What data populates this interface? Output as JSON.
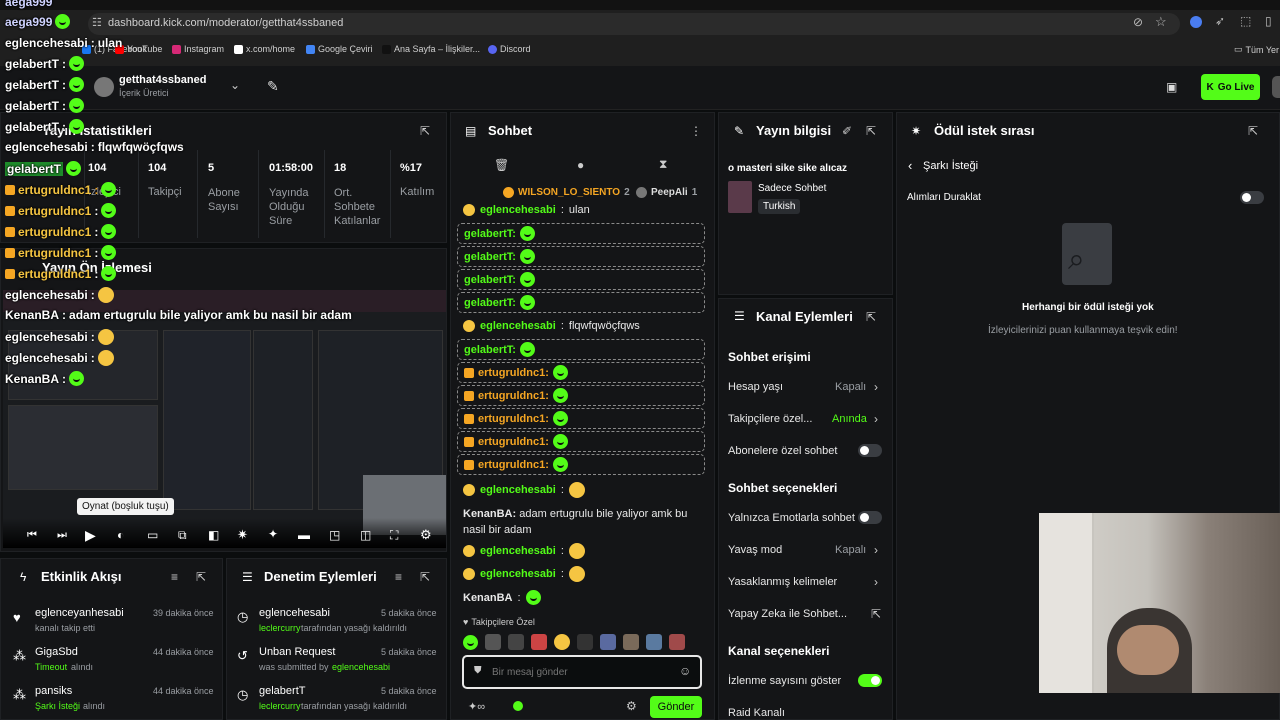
{
  "browser": {
    "url": "dashboard.kick.com/moderator/getthat4ssbaned",
    "bookmarks": [
      "(1) Facebook",
      "YouTube",
      "Instagram",
      "x.com/home",
      "Google Çeviri",
      "Ana Sayfa – İlişkiler...",
      "Discord"
    ],
    "all_bookmarks": "Tüm Yer"
  },
  "header": {
    "channel_name": "getthat4ssbaned",
    "role": "İçerik Üretici",
    "go_live": "Go Live"
  },
  "stats": {
    "title": "Yayın İstatistikleri",
    "values": [
      "104",
      "104",
      "5",
      "01:58:00",
      "18",
      "%17"
    ],
    "labels": [
      "İzleyici",
      "Takipçi",
      "Abone Sayısı",
      "Yayında Olduğu Süre",
      "Ort. Sohbete Katılanlar",
      "Katılım"
    ]
  },
  "preview": {
    "title": "Yayın Ön İzlemesi",
    "tooltip": "Oynat (boşluk tuşu)"
  },
  "overlay": [
    {
      "user": "aega999",
      "text": ""
    },
    {
      "user": "aega999",
      "text": ""
    },
    {
      "user": "eglencehesabi",
      "text": "ulan"
    },
    {
      "user": "gelabertT",
      "text": ""
    },
    {
      "user": "gelabertT",
      "text": ""
    },
    {
      "user": "gelabertT",
      "text": ""
    },
    {
      "user": "gelabertT",
      "text": ""
    },
    {
      "user": "eglencehesabi",
      "text": "flqwfqwöçfqws"
    },
    {
      "user": "gelabertT",
      "text": ""
    },
    {
      "user": "ertugruldnc1",
      "text": ""
    },
    {
      "user": "ertugruldnc1",
      "text": ""
    },
    {
      "user": "ertugruldnc1",
      "text": ""
    },
    {
      "user": "ertugruldnc1",
      "text": ""
    },
    {
      "user": "ertugruldnc1",
      "text": ""
    },
    {
      "user": "eglencehesabi",
      "text": ""
    },
    {
      "user": "KenanBA",
      "text": "adam ertugrulu bile yaliyor amk bu nasil bir adam"
    },
    {
      "user": "eglencehesabi",
      "text": ""
    },
    {
      "user": "eglencehesabi",
      "text": ""
    },
    {
      "user": "KenanBA",
      "text": ""
    }
  ],
  "activity": {
    "title": "Etkinlik Akışı",
    "items": [
      {
        "name": "eglenceyanhesabi",
        "desc": "kanalı takip etti",
        "time": "39 dakika önce"
      },
      {
        "name": "GigaSbd",
        "desc_hl": "Timeout",
        "desc": "alındı",
        "time": "44 dakika önce"
      },
      {
        "name": "pansiks",
        "desc_hl": "Şarkı İsteği",
        "desc": "alındı",
        "time": "44 dakika önce"
      }
    ]
  },
  "moderation": {
    "title": "Denetim Eylemleri",
    "items": [
      {
        "name": "eglencehesabi",
        "by": "leclercurry",
        "desc": "tarafından yasağı kaldırıldı",
        "time": "5 dakika önce"
      },
      {
        "name": "Unban Request",
        "by": "eglencehesabi",
        "desc": "was submitted by",
        "time": "5 dakika önce"
      },
      {
        "name": "gelabertT",
        "by": "leclercurry",
        "desc": "tarafından yasağı kaldırıldı",
        "time": "5 dakika önce"
      }
    ]
  },
  "chat": {
    "title": "Sohbet",
    "pinned_users": [
      {
        "name": "WILSON_LO_SIENTO",
        "count": "2"
      },
      {
        "name": "PeepAli",
        "count": "1"
      }
    ],
    "messages": [
      {
        "user": "eglencehesabi",
        "text": "ulan"
      },
      {
        "user": "gelabertT:",
        "text": ""
      },
      {
        "user": "gelabertT:",
        "text": ""
      },
      {
        "user": "gelabertT:",
        "text": ""
      },
      {
        "user": "gelabertT:",
        "text": ""
      },
      {
        "user": "eglencehesabi",
        "text": "flqwfqwöçfqws"
      },
      {
        "user": "gelabertT:",
        "text": ""
      },
      {
        "user": "ertugruldnc1:",
        "text": ""
      },
      {
        "user": "ertugruldnc1:",
        "text": ""
      },
      {
        "user": "ertugruldnc1:",
        "text": ""
      },
      {
        "user": "ertugruldnc1:",
        "text": ""
      },
      {
        "user": "ertugruldnc1:",
        "text": ""
      },
      {
        "user": "eglencehesabi",
        "text": ""
      },
      {
        "user": "KenanBA",
        "text": "adam ertugrulu bile yaliyor amk bu nasil bir adam"
      },
      {
        "user": "eglencehesabi",
        "text": ""
      },
      {
        "user": "eglencehesabi",
        "text": ""
      },
      {
        "user": "KenanBA",
        "text": ""
      }
    ],
    "followers_only": "Takipçilere Özel",
    "placeholder": "Bir mesaj gönder",
    "send": "Gönder"
  },
  "stream_info": {
    "title": "Yayın bilgisi",
    "stream_title": "o masteri sike sike alıcaz",
    "category": "Sadece Sohbet",
    "tag": "Turkish"
  },
  "channel_actions": {
    "title": "Kanal Eylemleri",
    "chat_access": "Sohbet erişimi",
    "account_age": "Hesap yaşı",
    "account_age_val": "Kapalı",
    "followers_only": "Takipçilere özel...",
    "followers_only_val": "Anında",
    "subs_only": "Abonelere özel sohbet",
    "chat_options": "Sohbet seçenekleri",
    "emote_only": "Yalnızca Emotlarla sohbet",
    "slow_mode": "Yavaş mod",
    "slow_mode_val": "Kapalı",
    "banned_words": "Yasaklanmış kelimeler",
    "ai_chat": "Yapay Zeka ile Sohbet...",
    "channel_options": "Kanal seçenekleri",
    "show_viewers": "İzlenme sayısını göster",
    "raid": "Raid Kanalı"
  },
  "rewards": {
    "title": "Ödül istek sırası",
    "back": "Şarkı İsteği",
    "pause": "Alımları Duraklat",
    "empty_title": "Herhangi bir ödül isteği yok",
    "empty_desc": "İzleyicilerinizi puan kullanmaya teşvik edin!"
  },
  "colors": {
    "accent": "#53fc18",
    "panel": "#141517",
    "bg": "#0b0d0e",
    "gold": "#f5a623"
  }
}
